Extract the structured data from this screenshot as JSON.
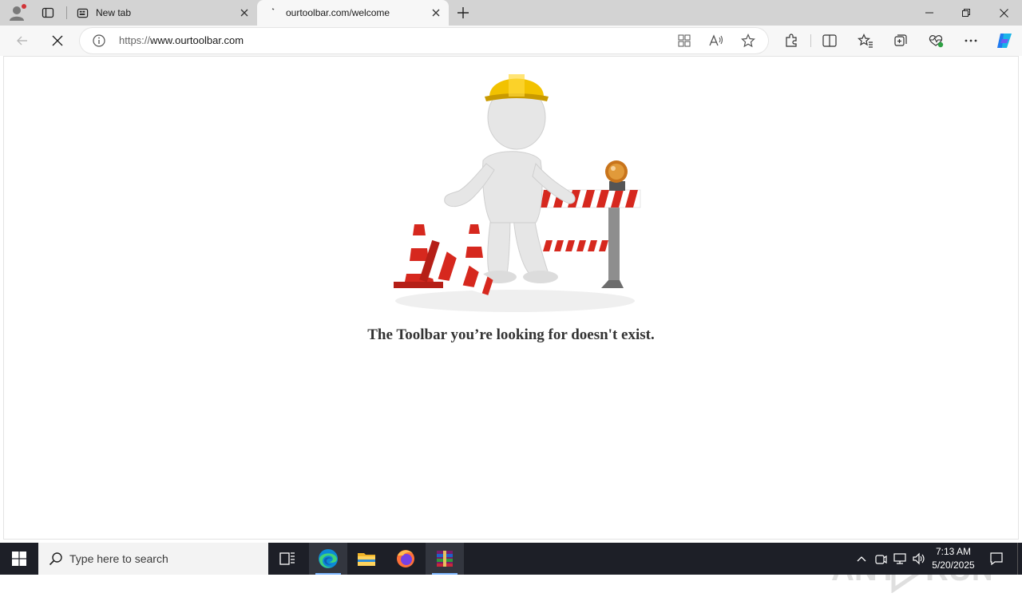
{
  "browser": {
    "tabs": [
      {
        "title": "New tab",
        "active": false,
        "icon": "newtab-page-icon"
      },
      {
        "title": "ourtoolbar.com/welcome",
        "active": true,
        "icon": "loading-icon"
      }
    ],
    "address": {
      "scheme": "https://",
      "host": "www.ourtoolbar.com"
    }
  },
  "page": {
    "message": "The Toolbar you’re looking for doesn't exist.",
    "illustration": "construction-worker-with-barrier-and-cones"
  },
  "watermark": {
    "text": "ANY RUN"
  },
  "taskbar": {
    "search_placeholder": "Type here to search",
    "apps": [
      "task-view-icon",
      "edge-icon",
      "file-explorer-icon",
      "firefox-icon",
      "winrar-icon"
    ],
    "clock": {
      "time": "7:13 AM",
      "date": "5/20/2025"
    }
  },
  "colors": {
    "tabstrip": "#d3d3d3",
    "toolbar": "#f7f7f7",
    "taskbar": "#1d1f27",
    "helmet": "#f2c200",
    "stripe_red": "#d6281e"
  }
}
